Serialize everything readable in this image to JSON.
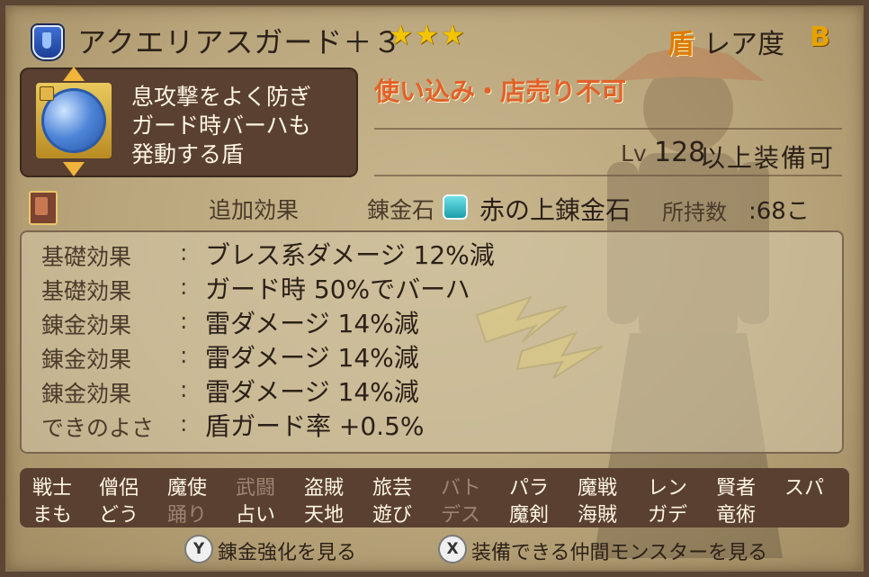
{
  "item": {
    "name": "アクエリアスガード＋３",
    "stars": "★★★",
    "rarity_category": "盾",
    "rarity_label": "レア度",
    "rarity_value": "B",
    "description_lines": [
      "息攻撃をよく防ぎ",
      "ガード時バーハも",
      "発動する盾"
    ],
    "warning": "使い込み・店売り不可",
    "level_prefix": "Lv",
    "level_value": "128",
    "level_suffix": "以上装備可"
  },
  "alchemy": {
    "tab_label": "追加効果",
    "stone_label": "錬金石",
    "stone_name": "赤の上錬金石",
    "owned_label": "所持数",
    "owned_value": ":68こ"
  },
  "effects": [
    {
      "label": "基礎効果",
      "text": "ブレス系ダメージ 12%減"
    },
    {
      "label": "基礎効果",
      "text": "ガード時 50%でバーハ"
    },
    {
      "label": "錬金効果",
      "text": "雷ダメージ 14%減"
    },
    {
      "label": "錬金効果",
      "text": "雷ダメージ 14%減"
    },
    {
      "label": "錬金効果",
      "text": "雷ダメージ 14%減"
    },
    {
      "label": "できのよさ",
      "text": "盾ガード率 +0.5%"
    }
  ],
  "colon": ":",
  "jobs_row1": [
    {
      "label": "戦士",
      "enabled": true
    },
    {
      "label": "僧侶",
      "enabled": true
    },
    {
      "label": "魔使",
      "enabled": true
    },
    {
      "label": "武闘",
      "enabled": false
    },
    {
      "label": "盗賊",
      "enabled": true
    },
    {
      "label": "旅芸",
      "enabled": true
    },
    {
      "label": "バト",
      "enabled": false
    },
    {
      "label": "パラ",
      "enabled": true
    },
    {
      "label": "魔戦",
      "enabled": true
    },
    {
      "label": "レン",
      "enabled": true
    },
    {
      "label": "賢者",
      "enabled": true
    },
    {
      "label": "スパ",
      "enabled": true
    }
  ],
  "jobs_row2": [
    {
      "label": "まも",
      "enabled": true
    },
    {
      "label": "どう",
      "enabled": true
    },
    {
      "label": "踊り",
      "enabled": false
    },
    {
      "label": "占い",
      "enabled": true
    },
    {
      "label": "天地",
      "enabled": true
    },
    {
      "label": "遊び",
      "enabled": true
    },
    {
      "label": "デス",
      "enabled": false
    },
    {
      "label": "魔剣",
      "enabled": true
    },
    {
      "label": "海賊",
      "enabled": true
    },
    {
      "label": "ガデ",
      "enabled": true
    },
    {
      "label": "竜術",
      "enabled": true
    }
  ],
  "footer": {
    "y_button": "Y",
    "y_label": "錬金強化を見る",
    "x_button": "X",
    "x_label": "装備できる仲間モンスターを見る"
  },
  "colors": {
    "parchment": "#c4b189",
    "panel_dark": "#5a4030",
    "warning": "#e2612a",
    "stars": "#f3c400",
    "rarity_category": "#e07a00"
  }
}
